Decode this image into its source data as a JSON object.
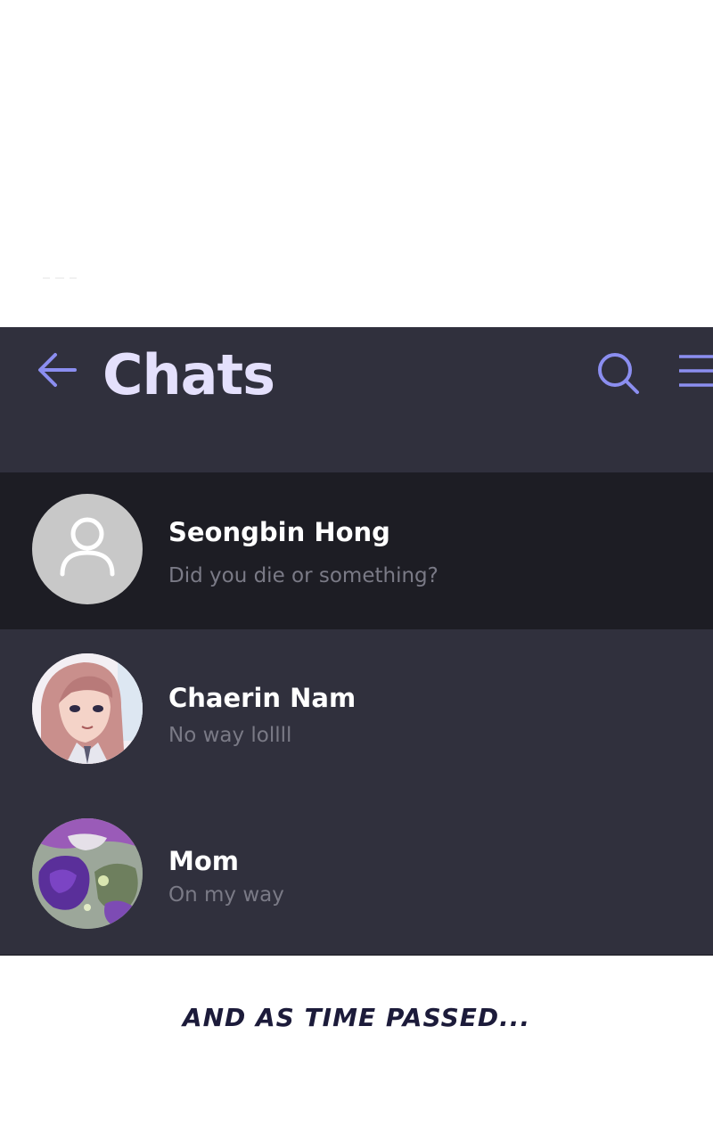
{
  "header": {
    "title": "Chats",
    "back_icon": "arrow-left-icon",
    "search_icon": "search-icon",
    "menu_icon": "hamburger-menu-icon",
    "accent_color": "#8b8ef0",
    "title_color": "#e4e0fc"
  },
  "chats": [
    {
      "name": "Seongbin Hong",
      "preview": "Did you die or something?",
      "avatar": "default-user-icon",
      "selected": true
    },
    {
      "name": "Chaerin Nam",
      "preview": "No way lollll",
      "avatar": "photo",
      "selected": false
    },
    {
      "name": "Mom",
      "preview": "On my way",
      "avatar": "photo",
      "selected": false
    }
  ],
  "caption": "AND AS TIME PASSED...",
  "colors": {
    "app_background": "#30303d",
    "selected_row": "#1d1d24",
    "name_text": "#ffffff",
    "preview_text": "#7a7a86",
    "caption_text": "#1c1b3a"
  }
}
